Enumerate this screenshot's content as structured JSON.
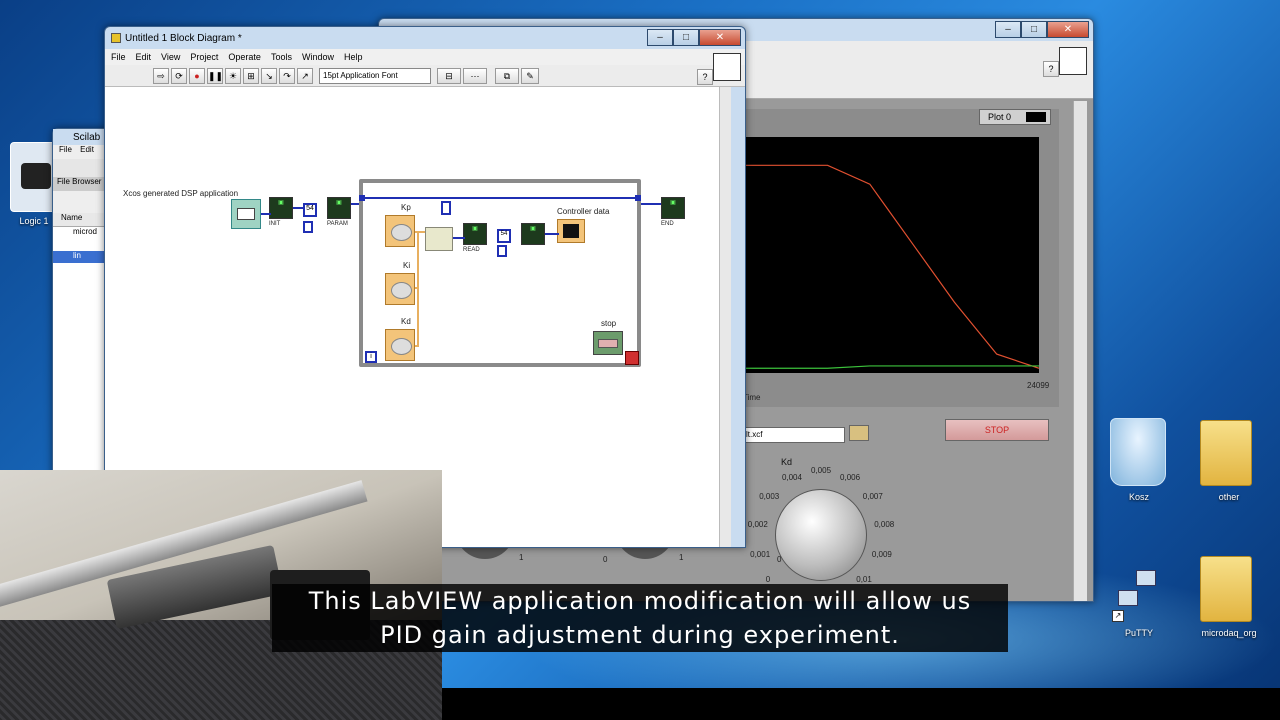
{
  "block_diagram": {
    "title": "Untitled 1 Block Diagram *",
    "menu": [
      "File",
      "Edit",
      "View",
      "Project",
      "Operate",
      "Tools",
      "Window",
      "Help"
    ],
    "font_select": "15pt Application Font",
    "diagram_label": "Xcos generated DSP application",
    "knobs": [
      "Kp",
      "Ki",
      "Kd"
    ],
    "controller_label": "Controller data",
    "stop_label": "stop",
    "block_texts": {
      "init": "INIT",
      "param": "PARAM",
      "read": "READ",
      "end": "END",
      "stop_btn": "STOP"
    }
  },
  "scilab_window": {
    "title": "Scilab",
    "menu": [
      "File",
      "Edit"
    ],
    "file_browser": "File Browser",
    "column_name": "Name",
    "items": [
      "microd",
      "lin"
    ]
  },
  "logic_icon_label": "Logic 1",
  "front_panel": {
    "plot_legend": "Plot 0",
    "x_axis_end": "24099",
    "x_axis_label": "Time",
    "path_value": "lt.xcf",
    "stop_button": "STOP",
    "kd_label": "Kd",
    "kd_ticks": [
      "0",
      "0,001",
      "0,002",
      "0,003",
      "0,004",
      "0,005",
      "0,006",
      "0,007",
      "0,008",
      "0,009",
      "0,01"
    ],
    "left_dial_ticks": [
      "1",
      "0",
      "1",
      "0"
    ]
  },
  "desktop_icons": [
    {
      "label": "Kosz",
      "icon": "recycle-bin-icon"
    },
    {
      "label": "other",
      "icon": "folder-icon"
    },
    {
      "label": "PuTTY",
      "icon": "putty-icon"
    },
    {
      "label": "microdaq_org",
      "icon": "folder-icon"
    }
  ],
  "subtitle": {
    "line1": "This LabVIEW application modification will allow us",
    "line2": "PID gain adjustment during experiment."
  },
  "colors": {
    "wire_blue": "#1f2fb3",
    "wire_orange": "#e8b060",
    "trace_red": "#e05030",
    "trace_green": "#3cc23c",
    "stop_red": "#d03030"
  },
  "chart_data": {
    "type": "line",
    "series": [
      {
        "values": [
          0.88,
          0.88,
          0.88,
          0.8,
          0.55,
          0.3,
          0.08,
          0.02
        ]
      },
      {
        "values": [
          0.02,
          0.02,
          0.02,
          0.03,
          0.03,
          0.03,
          0.03,
          0.03
        ]
      }
    ]
  }
}
